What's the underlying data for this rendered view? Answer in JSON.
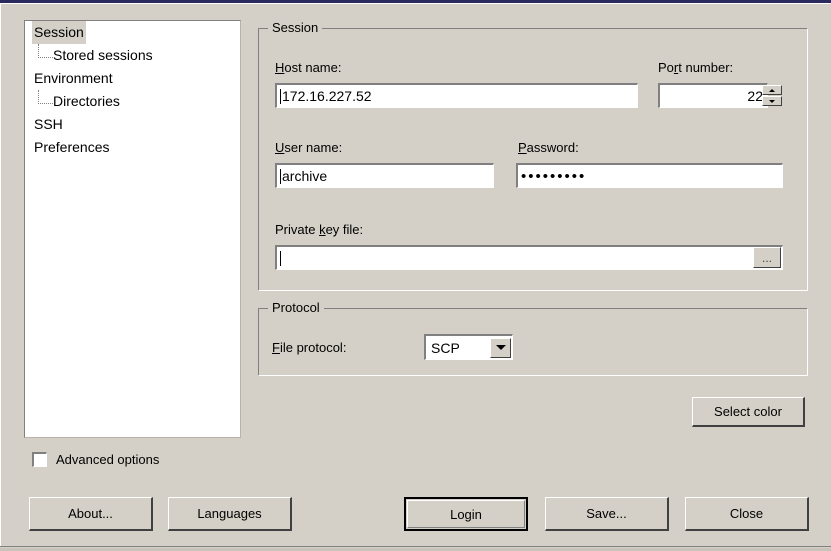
{
  "window": {
    "background_color": "#d4d0c8",
    "title_bar_color": "#2a2a5e"
  },
  "tree": {
    "items": [
      {
        "label": "Session",
        "level": 0,
        "selected": true
      },
      {
        "label": "Stored sessions",
        "level": 1,
        "selected": false
      },
      {
        "label": "Environment",
        "level": 0,
        "selected": false
      },
      {
        "label": "Directories",
        "level": 1,
        "selected": false
      },
      {
        "label": "SSH",
        "level": 0,
        "selected": false
      },
      {
        "label": "Preferences",
        "level": 0,
        "selected": false
      }
    ]
  },
  "session_group": {
    "title": "Session",
    "host_label_pre": "H",
    "host_label_post": "ost name:",
    "host_value": "172.16.227.52",
    "port_label_pre": "Po",
    "port_label_mid": "r",
    "port_label_post": "t number:",
    "port_value": "22",
    "user_label_pre": "U",
    "user_label_post": "ser name:",
    "user_value": "archive",
    "password_label_pre": "P",
    "password_label_post": "assword:",
    "password_value": "•••••••••",
    "key_label_pre": "Private ",
    "key_label_mid": "k",
    "key_label_post": "ey file:",
    "key_value": "",
    "browse_label": "..."
  },
  "protocol_group": {
    "title": "Protocol",
    "file_protocol_label_pre": "F",
    "file_protocol_label_post": "ile protocol:",
    "file_protocol_value": "SCP",
    "file_protocol_options": [
      "SCP"
    ]
  },
  "advanced": {
    "label": "Advanced options",
    "checked": false
  },
  "buttons": {
    "select_color": "Select color",
    "about": "About...",
    "languages": "Languages",
    "login": "Login",
    "save": "Save...",
    "close": "Close"
  },
  "icons": {
    "spinner_up": "triangle-up-icon",
    "spinner_down": "triangle-down-icon",
    "combo_arrow": "chevron-down-icon"
  }
}
